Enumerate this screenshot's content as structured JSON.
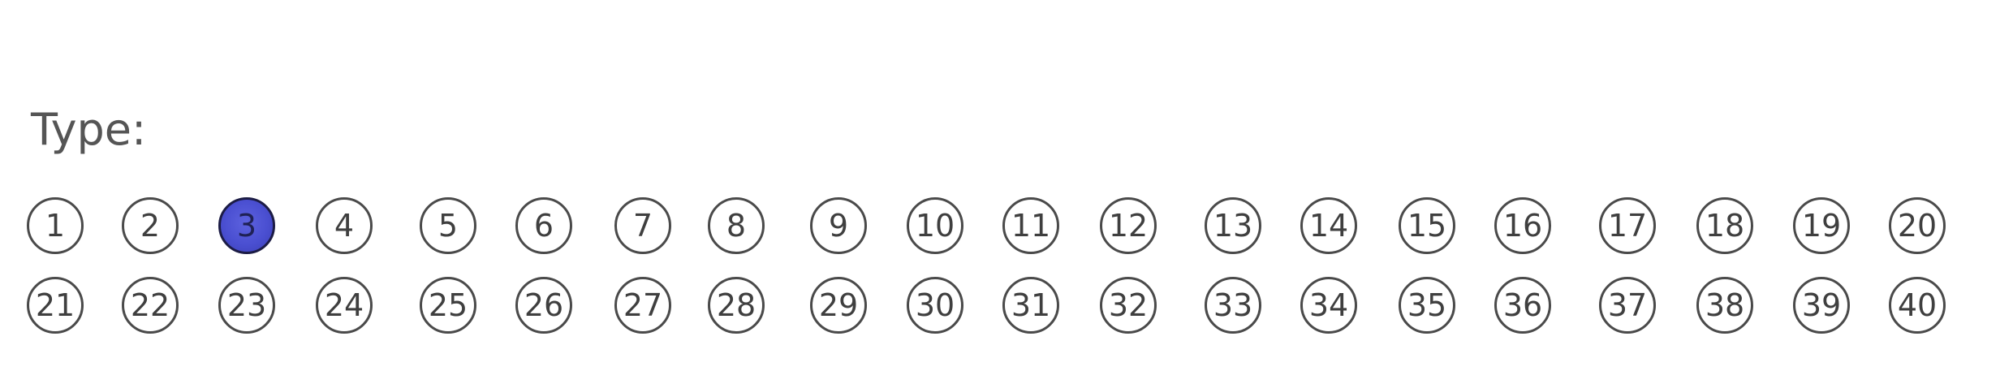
{
  "form": {
    "type_label": "Type:",
    "selected_value": "3",
    "selected_color": "#4a4fd1",
    "rows": [
      [
        "1",
        "2",
        "3",
        "4",
        "5",
        "6",
        "7",
        "8",
        "9",
        "10",
        "11",
        "12",
        "13",
        "14",
        "15",
        "16",
        "17",
        "18",
        "19",
        "20"
      ],
      [
        "21",
        "22",
        "23",
        "24",
        "25",
        "26",
        "27",
        "28",
        "29",
        "30",
        "31",
        "32",
        "33",
        "34",
        "35",
        "36",
        "37",
        "38",
        "39",
        "40"
      ]
    ]
  }
}
